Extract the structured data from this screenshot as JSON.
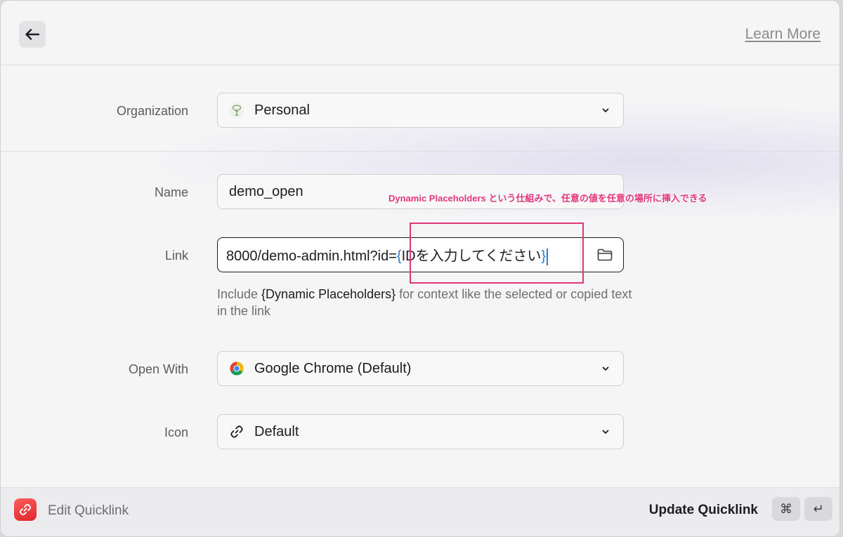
{
  "header": {
    "back_icon": "arrow-left-icon",
    "learn_more": "Learn More"
  },
  "form": {
    "organization": {
      "label": "Organization",
      "value": "Personal",
      "icon": "tree-icon"
    },
    "name": {
      "label": "Name",
      "value": "demo_open"
    },
    "link": {
      "label": "Link",
      "value_prefix": "8000/demo-admin.html?id=",
      "brace_open": "{",
      "placeholder_text": "IDを入力してください",
      "brace_close": "}",
      "folder_icon": "folder-icon"
    },
    "help": {
      "prefix": "Include ",
      "placeholder": "{Dynamic Placeholders}",
      "suffix": " for context like the selected or copied text in the link"
    },
    "open_with": {
      "label": "Open With",
      "value": "Google Chrome (Default)",
      "icon": "chrome-icon"
    },
    "icon_field": {
      "label": "Icon",
      "value": "Default",
      "icon": "link-icon"
    }
  },
  "annotation": {
    "text": "Dynamic Placeholders という仕組みで、任意の値を任意の場所に挿入できる",
    "color": "#e0357a"
  },
  "footer": {
    "title": "Edit Quicklink",
    "primary_action": "Update Quicklink",
    "shortcut_cmd": "⌘",
    "shortcut_return": "↵"
  }
}
